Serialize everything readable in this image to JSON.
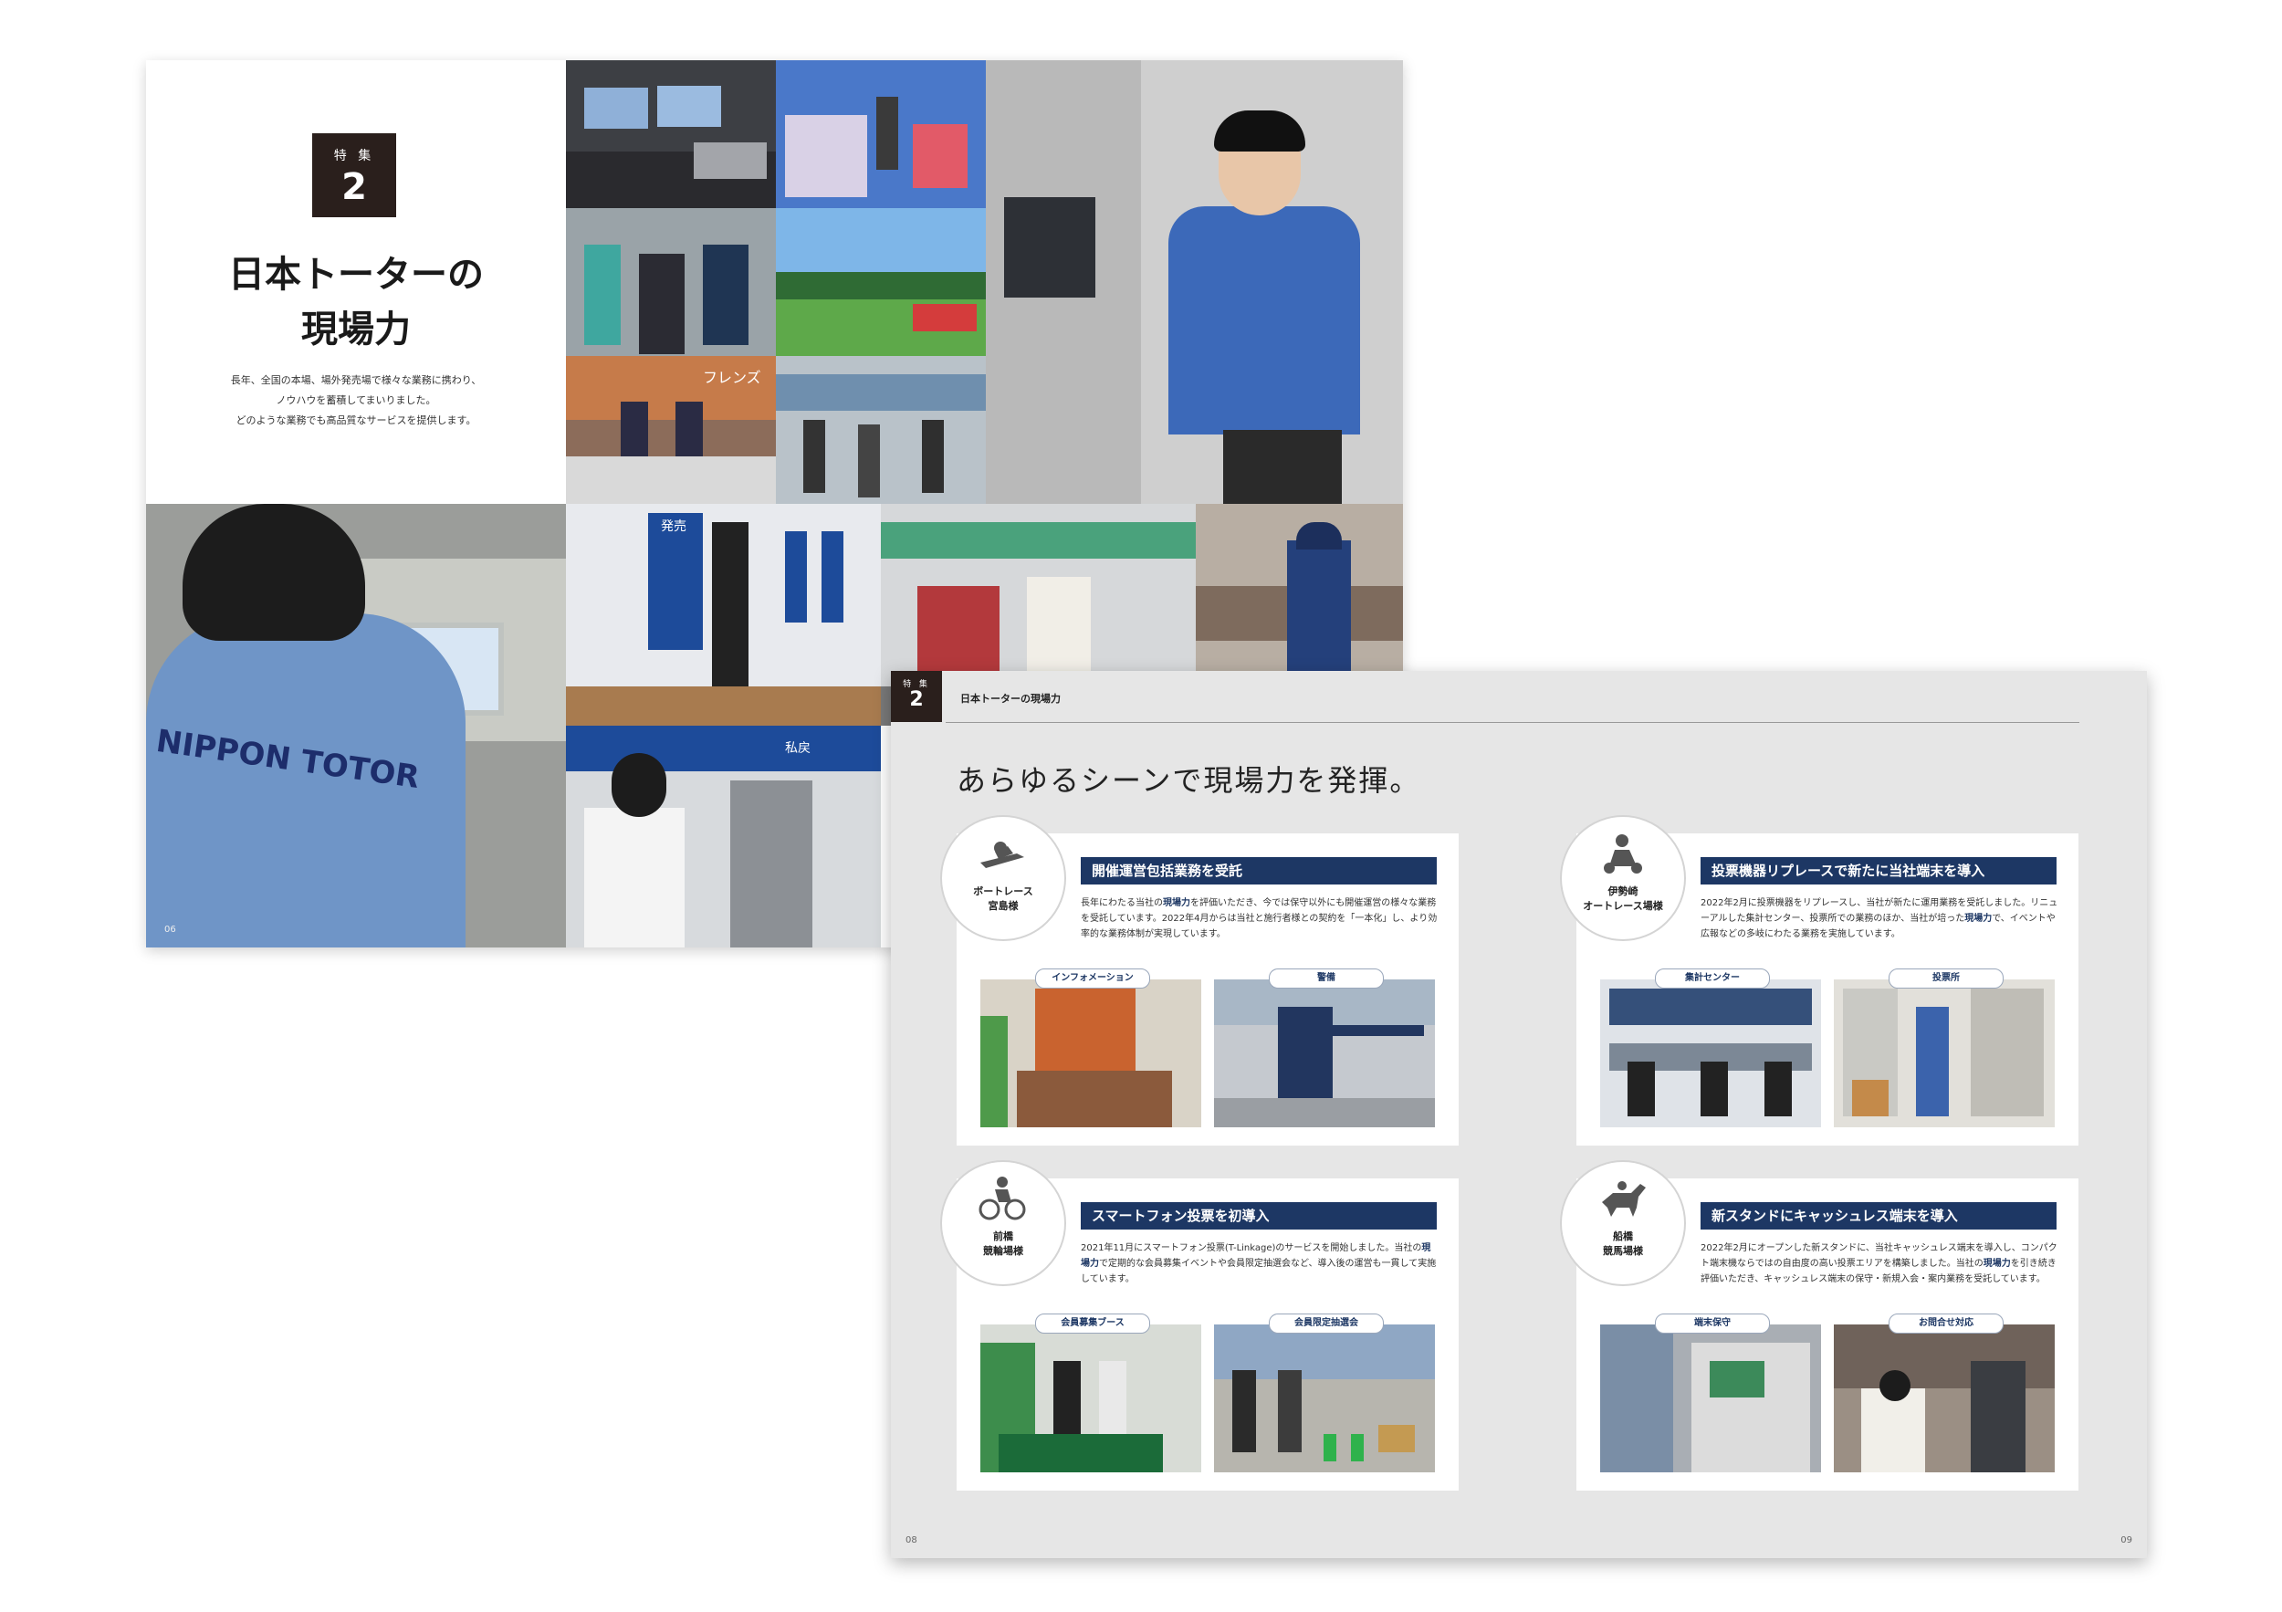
{
  "back_spread": {
    "badge_label": "特 集",
    "badge_number": "2",
    "title_line1": "日本トーターの",
    "title_line2": "現場力",
    "lead_line1": "長年、全国の本場、場外発売場で様々な業務に携わり、",
    "lead_line2": "ノウハウを蓄積してまいりました。",
    "lead_line3": "どのような業務でも高品質なサービスを提供します。",
    "page_number": "06",
    "photo_texts": {
      "uniform": "NIPPON TOTOR",
      "sign_sales": "発売",
      "sign_cashier": "私戻",
      "sign_friends": "フレンズ"
    }
  },
  "front_spread": {
    "tag_label": "特 集",
    "tag_number": "2",
    "header_title": "日本トーターの現場力",
    "heading": "あらゆるシーンで現場力を発揮。",
    "page_left": "08",
    "page_right": "09",
    "cards": [
      {
        "venue_line1": "ボートレース",
        "venue_line2": "宮島様",
        "icon": "boat-race-icon",
        "title": "開催運営包括業務を受託",
        "body_a": "長年にわたる当社の",
        "body_em": "現場力",
        "body_b": "を評価いただき、今では保守以外にも開催運営の様々な業務を受託しています。2022年4月からは当社と施行者様との契約を「一本化」し、より効率的な業務体制が実現しています。",
        "photo_left_label": "インフォメーション",
        "photo_right_label": "警備"
      },
      {
        "venue_line1": "伊勢崎",
        "venue_line2": "オートレース場様",
        "icon": "auto-race-icon",
        "title": "投票機器リプレースで新たに当社端末を導入",
        "body_a": "2022年2月に投票機器をリプレースし、当社が新たに運用業務を受託しました。リニューアルした集計センター、投票所での業務のほか、当社が培った",
        "body_em": "現場力",
        "body_b": "で、イベントや広報などの多岐にわたる業務を実施しています。",
        "photo_left_label": "集計センター",
        "photo_right_label": "投票所"
      },
      {
        "venue_line1": "前橋",
        "venue_line2": "競輪場様",
        "icon": "cycling-icon",
        "title": "スマートフォン投票を初導入",
        "body_a": "2021年11月にスマートフォン投票(T-Linkage)のサービスを開始しました。当社の",
        "body_em": "現場力",
        "body_b": "で定期的な会員募集イベントや会員限定抽選会など、導入後の運営も一貫して実施しています。",
        "photo_left_label": "会員募集ブース",
        "photo_right_label": "会員限定抽選会"
      },
      {
        "venue_line1": "船橋",
        "venue_line2": "競馬場様",
        "icon": "horse-race-icon",
        "title": "新スタンドにキャッシュレス端末を導入",
        "body_a": "2022年2月にオープンした新スタンドに、当社キャッシュレス端末を導入し、コンパクト端末機ならではの自由度の高い投票エリアを構築しました。当社の",
        "body_em": "現場力",
        "body_b": "を引き続き評価いただき、キャッシュレス端末の保守・新規入会・案内業務を受託しています。",
        "photo_left_label": "端末保守",
        "photo_right_label": "お問合せ対応"
      }
    ]
  }
}
